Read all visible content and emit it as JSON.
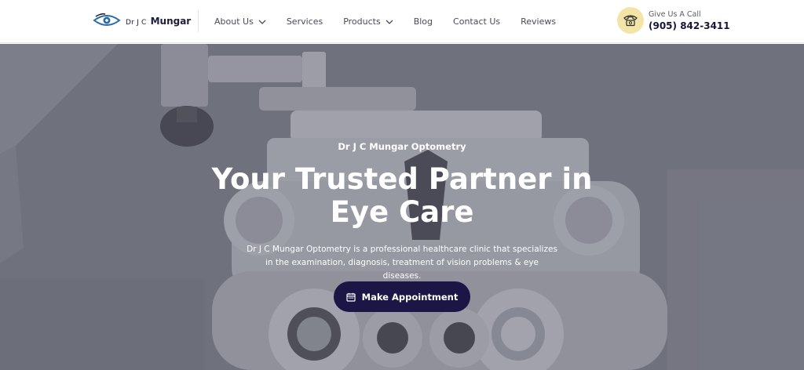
{
  "header": {
    "logo_prefix": "Dr J C",
    "logo_name": "Mungar",
    "nav": [
      {
        "label": "About Us",
        "has_dropdown": true
      },
      {
        "label": "Services",
        "has_dropdown": false
      },
      {
        "label": "Products",
        "has_dropdown": true
      },
      {
        "label": "Blog",
        "has_dropdown": false
      },
      {
        "label": "Contact Us",
        "has_dropdown": false
      },
      {
        "label": "Reviews",
        "has_dropdown": false
      }
    ],
    "call_label": "Give Us A Call",
    "phone": "(905) 842-3411",
    "call_icon": "phone-icon"
  },
  "hero": {
    "eyebrow": "Dr J C Mungar Optometry",
    "title": "Your Trusted Partner in Eye Care",
    "description": "Dr J C Mungar Optometry is a professional healthcare clinic that specializes in the examination, diagnosis, treatment of vision problems & eye diseases.",
    "cta_label": "Make Appointment",
    "cta_icon": "calendar-icon"
  },
  "colors": {
    "brand_dark": "#1b1646",
    "call_circle": "#f3e5a8",
    "logo_blue": "#2b6aa8"
  }
}
